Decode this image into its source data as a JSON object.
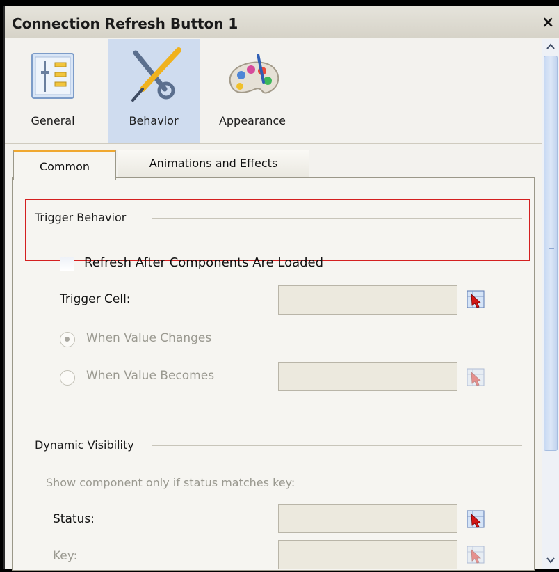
{
  "panel": {
    "title": "Connection Refresh Button 1",
    "close_glyph": "×"
  },
  "toolbar": {
    "buttons": [
      {
        "label": "General",
        "icon": "general-properties-icon",
        "active": false
      },
      {
        "label": "Behavior",
        "icon": "tools-wrench-screwdriver-icon",
        "active": true
      },
      {
        "label": "Appearance",
        "icon": "paint-palette-icon",
        "active": false
      }
    ]
  },
  "tabs": [
    {
      "label": "Common",
      "active": true
    },
    {
      "label": "Animations and Effects",
      "active": false
    }
  ],
  "trigger_behavior": {
    "group_label": "Trigger Behavior",
    "checkbox_label": "Refresh After Components Are Loaded",
    "checked": false,
    "trigger_cell_label": "Trigger Cell:",
    "trigger_cell_value": "",
    "radio_when_changes": "When Value Changes",
    "radio_when_becomes": "When Value Becomes",
    "when_becomes_value": ""
  },
  "dynamic_visibility": {
    "group_label": "Dynamic Visibility",
    "hint": "Show component only if status matches key:",
    "status_label": "Status:",
    "status_value": "",
    "key_label": "Key:",
    "key_value": ""
  },
  "colors": {
    "highlight_border": "#d42020",
    "active_toolbar_bg": "#cfdcef",
    "active_tab_accent": "#f0a830"
  }
}
